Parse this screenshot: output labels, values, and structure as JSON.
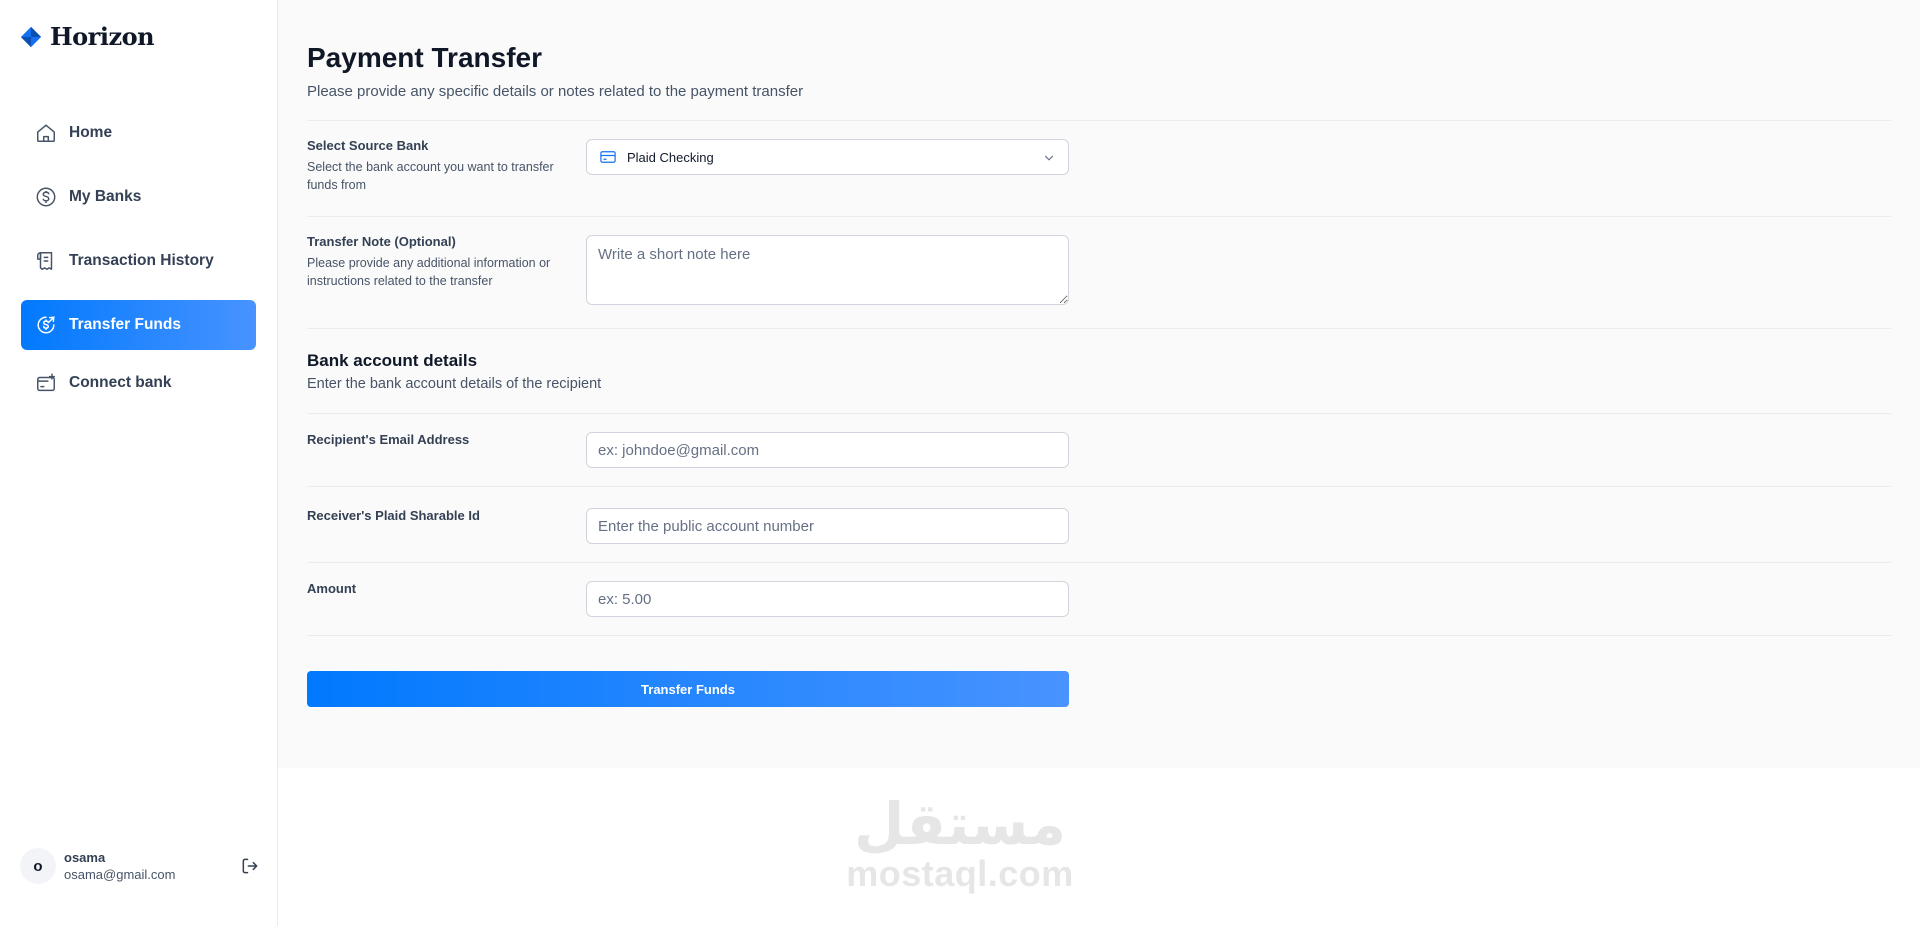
{
  "app": {
    "name": "Horizon"
  },
  "sidebar": {
    "items": [
      {
        "label": "Home",
        "icon": "home-icon"
      },
      {
        "label": "My Banks",
        "icon": "dollar-circle-icon"
      },
      {
        "label": "Transaction History",
        "icon": "receipt-icon"
      },
      {
        "label": "Transfer Funds",
        "icon": "money-send-icon",
        "active": true
      },
      {
        "label": "Connect bank",
        "icon": "connect-bank-icon"
      }
    ],
    "active_color": "#0179fe"
  },
  "user": {
    "initial": "o",
    "name": "osama",
    "email": "osama@gmail.com"
  },
  "page": {
    "title": "Payment Transfer",
    "subtitle": "Please provide any specific details or notes related to the payment transfer"
  },
  "form": {
    "source_bank": {
      "label": "Select Source Bank",
      "description": "Select the bank account you want to transfer funds from",
      "value": "Plaid Checking"
    },
    "note": {
      "label": "Transfer Note (Optional)",
      "description": "Please provide any additional information or instructions related to the transfer",
      "placeholder": "Write a short note here"
    },
    "bank_details": {
      "title": "Bank account details",
      "subtitle": "Enter the bank account details of the recipient"
    },
    "email": {
      "label": "Recipient's Email Address",
      "placeholder": "ex: johndoe@gmail.com"
    },
    "sharable_id": {
      "label": "Receiver's Plaid Sharable Id",
      "placeholder": "Enter the public account number"
    },
    "amount": {
      "label": "Amount",
      "placeholder": "ex: 5.00"
    },
    "submit_label": "Transfer Funds"
  },
  "watermark": {
    "arabic": "مستقل",
    "latin": "mostaql.com"
  }
}
